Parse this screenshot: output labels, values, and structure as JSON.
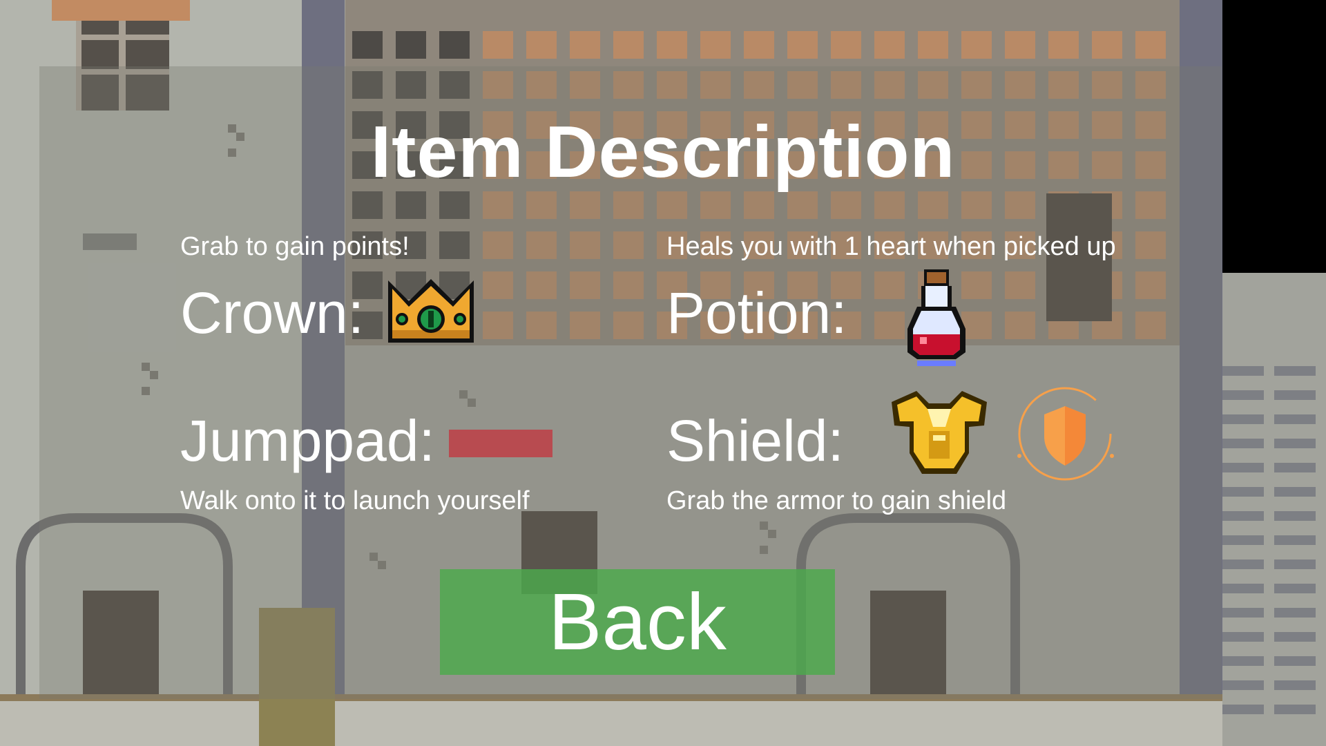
{
  "screen": {
    "title": "Item Description"
  },
  "items": [
    {
      "id": "crown",
      "label": "Crown:",
      "description": "Grab to gain points!",
      "icon": "crown-icon"
    },
    {
      "id": "potion",
      "label": "Potion:",
      "description": "Heals you with 1 heart when picked up",
      "icon": "potion-icon"
    },
    {
      "id": "jumppad",
      "label": "Jumppad:",
      "description": "Walk onto it to launch yourself",
      "icon": "jumppad-block"
    },
    {
      "id": "shield",
      "label": "Shield:",
      "description": "Grab the armor to gain shield",
      "icon": "armor-icon",
      "extra_icon": "shield-badge-icon"
    }
  ],
  "back_button": {
    "label": "Back"
  },
  "colors": {
    "button_green": "#4caa4c",
    "jumppad_red": "#b84b50",
    "crown_gold": "#f0a830",
    "potion_red": "#c8102e",
    "armor_gold": "#f5c02a",
    "shield_orange": "#f7a04a"
  }
}
